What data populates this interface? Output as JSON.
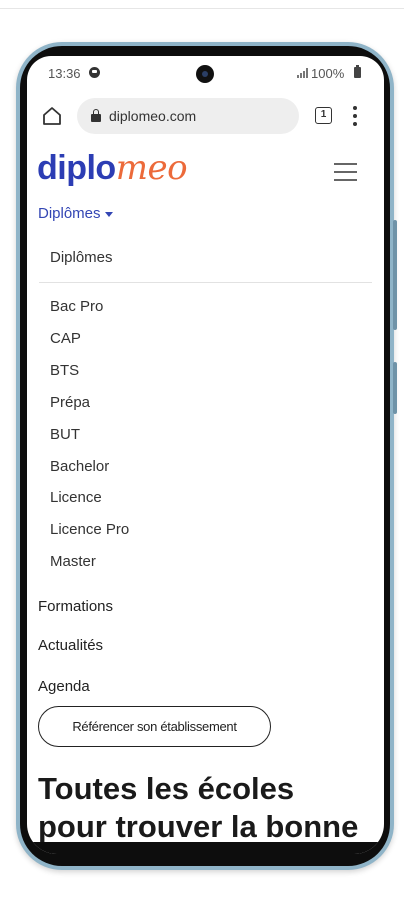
{
  "status_bar": {
    "time": "13:36",
    "battery_percent": "100%"
  },
  "browser": {
    "url": "diplomeo.com",
    "tab_count": "1"
  },
  "site": {
    "logo_part1": "diplo",
    "logo_part2": "meo",
    "colors": {
      "brand_blue": "#2c3db4",
      "brand_orange": "#ec6a3a"
    }
  },
  "nav": {
    "dropdown_toggle": "Diplômes",
    "dropdown_header": "Diplômes",
    "dropdown_items": [
      "Bac Pro",
      "CAP",
      "BTS",
      "Prépa",
      "BUT",
      "Bachelor",
      "Licence",
      "Licence Pro",
      "Master"
    ],
    "links": [
      "Formations",
      "Actualités",
      "Agenda"
    ],
    "cta": "Référencer son établissement"
  },
  "hero": {
    "line1": "Toutes les écoles",
    "line2": "pour trouver la bonne"
  }
}
